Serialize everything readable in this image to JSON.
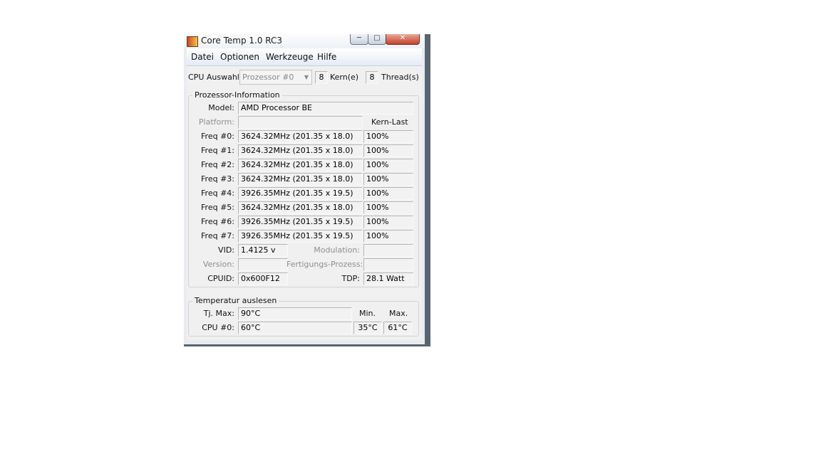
{
  "window": {
    "title": "Core Temp 1.0 RC3",
    "controls": {
      "minimize": "─",
      "maximize": "□",
      "close": "✕"
    }
  },
  "menu": [
    "Datei",
    "Optionen",
    "Werkzeuge",
    "Hilfe"
  ],
  "cpu_select": {
    "label": "CPU Auswahl:",
    "value": "Prozessor #0",
    "cores": "8",
    "cores_label": "Kern(e)",
    "threads": "8",
    "threads_label": "Thread(s)"
  },
  "processor_info": {
    "title": "Prozessor-Information",
    "model_label": "Model:",
    "model": "AMD Processor  BE",
    "platform_label": "Platform:",
    "platform": "",
    "load_header": "Kern-Last",
    "freqs": [
      {
        "label": "Freq #0:",
        "value": "3624.32MHz (201.35 x 18.0)",
        "load": "100%"
      },
      {
        "label": "Freq #1:",
        "value": "3624.32MHz (201.35 x 18.0)",
        "load": "100%"
      },
      {
        "label": "Freq #2:",
        "value": "3624.32MHz (201.35 x 18.0)",
        "load": "100%"
      },
      {
        "label": "Freq #3:",
        "value": "3624.32MHz (201.35 x 18.0)",
        "load": "100%"
      },
      {
        "label": "Freq #4:",
        "value": "3926.35MHz (201.35 x 19.5)",
        "load": "100%"
      },
      {
        "label": "Freq #5:",
        "value": "3624.32MHz (201.35 x 18.0)",
        "load": "100%"
      },
      {
        "label": "Freq #6:",
        "value": "3926.35MHz (201.35 x 19.5)",
        "load": "100%"
      },
      {
        "label": "Freq #7:",
        "value": "3926.35MHz (201.35 x 19.5)",
        "load": "100%"
      }
    ],
    "vid_label": "VID:",
    "vid": "1.4125 v",
    "modulation_label": "Modulation:",
    "modulation": "",
    "version_label": "Version:",
    "version": "",
    "process_label": "Fertigungs-Prozess:",
    "process": "",
    "cpuid_label": "CPUID:",
    "cpuid": "0x600F12",
    "tdp_label": "TDP:",
    "tdp": "28.1 Watt"
  },
  "temperature": {
    "title": "Temperatur auslesen",
    "tjmax_label": "Tj. Max:",
    "tjmax": "90°C",
    "min_header": "Min.",
    "max_header": "Max.",
    "cpu_label": "CPU #0:",
    "cpu_temp": "60°C",
    "cpu_min": "35°C",
    "cpu_max": "61°C"
  },
  "colors": {
    "window_frame": "#5a6470",
    "client_bg": "#f0f0f0",
    "close_button": "#c5412b"
  }
}
